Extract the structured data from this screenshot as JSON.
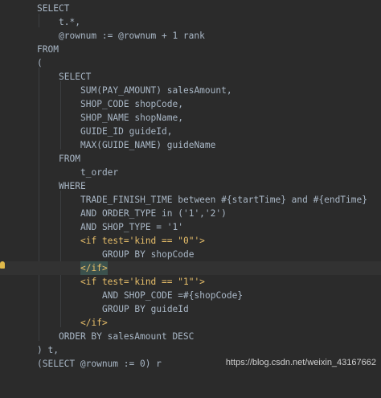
{
  "editor": {
    "lines": [
      {
        "text": "SELECT"
      },
      {
        "text": "t.*,"
      },
      {
        "text": "@rownum := @rownum + 1 rank"
      },
      {
        "text": "FROM"
      },
      {
        "text": "("
      },
      {
        "text": "SELECT"
      },
      {
        "text": "SUM(PAY_AMOUNT) salesAmount,"
      },
      {
        "text": "SHOP_CODE shopCode,"
      },
      {
        "text": "SHOP_NAME shopName,"
      },
      {
        "text": "GUIDE_ID guideId,"
      },
      {
        "text": "MAX(GUIDE_NAME) guideName"
      },
      {
        "text": "FROM"
      },
      {
        "text": "t_order"
      },
      {
        "text": "WHERE"
      },
      {
        "text": "TRADE_FINISH_TIME between #{startTime} and #{endTime}"
      },
      {
        "text": "AND ORDER_TYPE in ('1','2')"
      },
      {
        "text": "AND SHOP_TYPE = '1'"
      },
      {
        "text": "<if test='kind == \"0\"'>"
      },
      {
        "text": "GROUP BY shopCode"
      },
      {
        "text": "</if>"
      },
      {
        "text": "<if test='kind == \"1\"'>"
      },
      {
        "text": "AND SHOP_CODE =#{shopCode}"
      },
      {
        "text": "GROUP BY guideId"
      },
      {
        "text": "</if>"
      },
      {
        "text": "ORDER BY salesAmount DESC"
      },
      {
        "text": ") t,"
      },
      {
        "text": "(SELECT @rownum := 0) r"
      }
    ]
  },
  "watermark": "https://blog.csdn.net/weixin_43167662",
  "colors": {
    "background": "#2b2b2b",
    "text": "#a9b7c6",
    "xml_tag": "#e8bf6a",
    "string": "#6a8759",
    "current_line": "#323232",
    "tag_highlight": "#3b514d",
    "bulb": "#e0b94a"
  },
  "icons": {
    "gutter": "lightbulb-icon"
  }
}
